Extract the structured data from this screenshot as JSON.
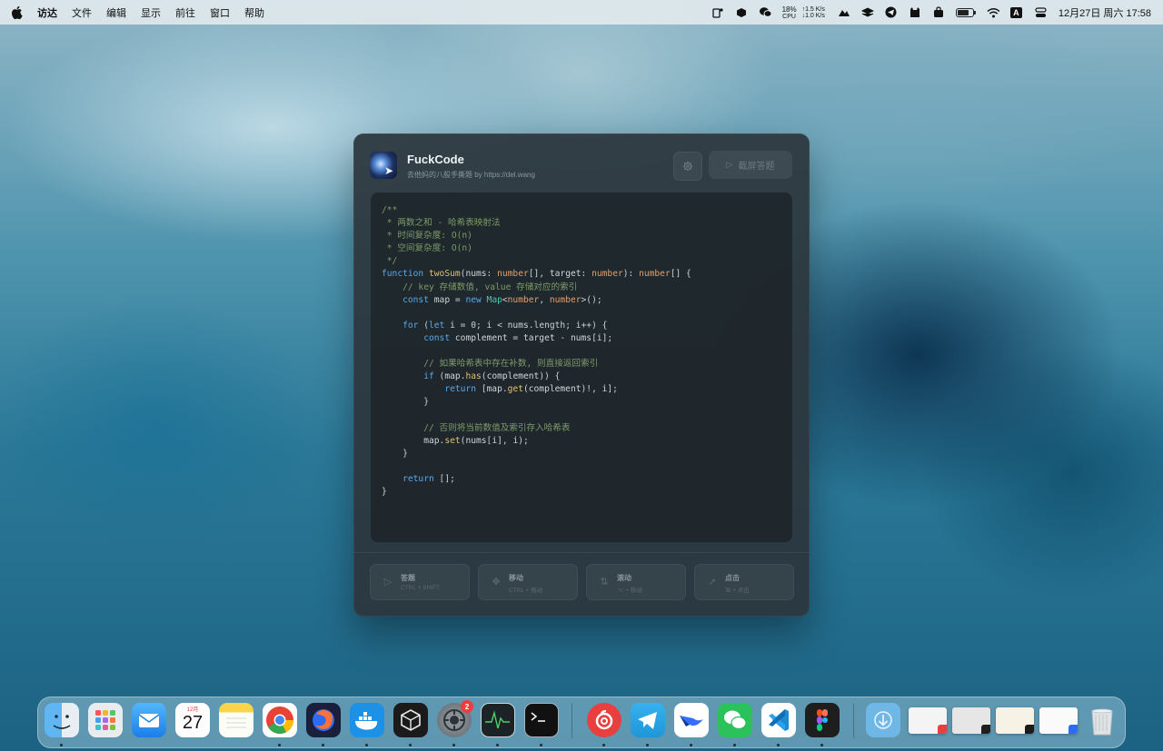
{
  "menubar": {
    "app_name": "访达",
    "menus": [
      "文件",
      "编辑",
      "显示",
      "前往",
      "窗口",
      "帮助"
    ],
    "cpu_percent": "18%",
    "cpu_label": "CPU",
    "net_up": "↑1.5 K/s",
    "net_down": "↓1.0 K/s",
    "input_method": "A",
    "clock": "12月27日 周六  17:58"
  },
  "window": {
    "title": "FuckCode",
    "subtitle": "去他妈的八股手撕题 by https://del.wang",
    "capture_label": "截屏答题",
    "actions": [
      {
        "label": "答题",
        "shortcut": "CTRL + SHIFT",
        "icon": "play-icon"
      },
      {
        "label": "移动",
        "shortcut": "CTRL + 拖动",
        "icon": "move-icon"
      },
      {
        "label": "滚动",
        "shortcut": "⌥ + 移动",
        "icon": "scroll-icon"
      },
      {
        "label": "点击",
        "shortcut": "⌘ + 点击",
        "icon": "cursor-icon"
      }
    ]
  },
  "code": {
    "doc_open": "/**",
    "doc_1": " * 两数之和 - 哈希表映射法",
    "doc_2": " * 时间复杂度: O(n)",
    "doc_3": " * 空间复杂度: O(n)",
    "doc_close": " */",
    "comment_map": "// key 存储数值, value 存储对应的索引",
    "comment_check": "// 如果哈希表中存在补数, 则直接返回索引",
    "comment_store": "// 否则将当前数值及索引存入哈希表"
  },
  "dock": {
    "calendar_month": "12月",
    "calendar_day": "27",
    "settings_badge": "2",
    "apps": [
      "finder-icon",
      "launchpad-icon",
      "mail-icon",
      "calendar-icon",
      "notes-icon",
      "chrome-icon",
      "firefox-icon",
      "docker-icon",
      "cube-app-icon",
      "system-settings-icon",
      "activity-monitor-icon",
      "terminal-icon",
      "netease-music-icon",
      "telegram-icon",
      "lark-icon",
      "wechat-icon",
      "vscode-icon",
      "figma-icon",
      "downloads-icon",
      "trash-icon"
    ]
  },
  "colors": {
    "window_bg": "#2c363c",
    "code_bg": "#1e262a",
    "keyword": "#5aa8e8",
    "function": "#e0c070",
    "type": "#e2a070",
    "comment": "#7d9b6a",
    "class": "#4ec9b0"
  }
}
